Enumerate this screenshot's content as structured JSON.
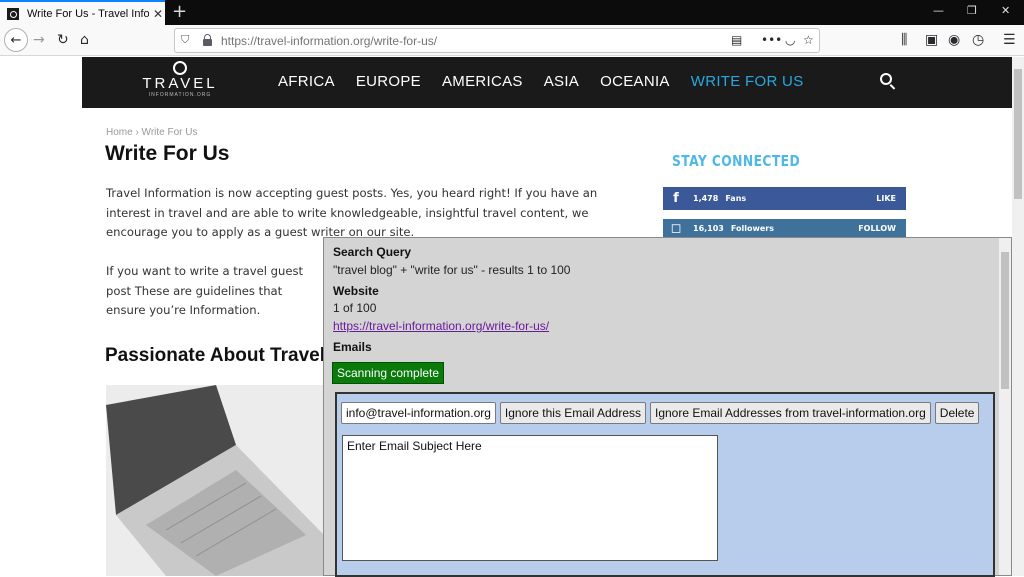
{
  "browser": {
    "tab_title": "Write For Us - Travel Informatic",
    "tab_close": "✕",
    "new_tab": "+",
    "url": "https://travel-information.org/write-for-us/",
    "window_controls": {
      "minimize": "—",
      "restore": "❐",
      "close": "✕"
    }
  },
  "site": {
    "logo_word": "TRAVEL",
    "logo_sub": "INFORMATION.ORG",
    "nav": [
      "AFRICA",
      "EUROPE",
      "AMERICAS",
      "ASIA",
      "OCEANIA",
      "WRITE FOR US"
    ],
    "active_nav": "WRITE FOR US",
    "accent_color": "#29a8e0"
  },
  "page": {
    "breadcrumb": "Home  ›  Write For Us",
    "title": "Write For Us",
    "para1": "Travel Information is now accepting guest posts. Yes, you heard right! If you have an interest in travel and are able to write knowledgeable, insightful travel content, we encourage you to apply as a guest writer on our site.",
    "para2": "If you want to write a travel guest post These are guidelines that ensure you’re Information.",
    "subheading": "Passionate About Travel"
  },
  "sidebar": {
    "heading": "STAY CONNECTED",
    "facebook": {
      "count": "1,478",
      "label": "Fans",
      "action": "LIKE"
    },
    "instagram": {
      "count": "16,103",
      "label": "Followers",
      "action": "FOLLOW"
    }
  },
  "overlay": {
    "search_query_label": "Search Query",
    "search_query_value": "\"travel blog\" + \"write for us\" - results 1 to 100",
    "website_label": "Website",
    "website_position": "1 of 100",
    "website_url": "https://travel-information.org/write-for-us/",
    "emails_label": "Emails",
    "status_button": "Scanning complete",
    "email_address": "info@travel-information.org",
    "ignore_email_button": "Ignore this Email Address",
    "ignore_domain_button": "Ignore Email Addresses from travel-information.org",
    "delete_button": "Delete",
    "subject_placeholder": "Enter Email Subject Here"
  }
}
